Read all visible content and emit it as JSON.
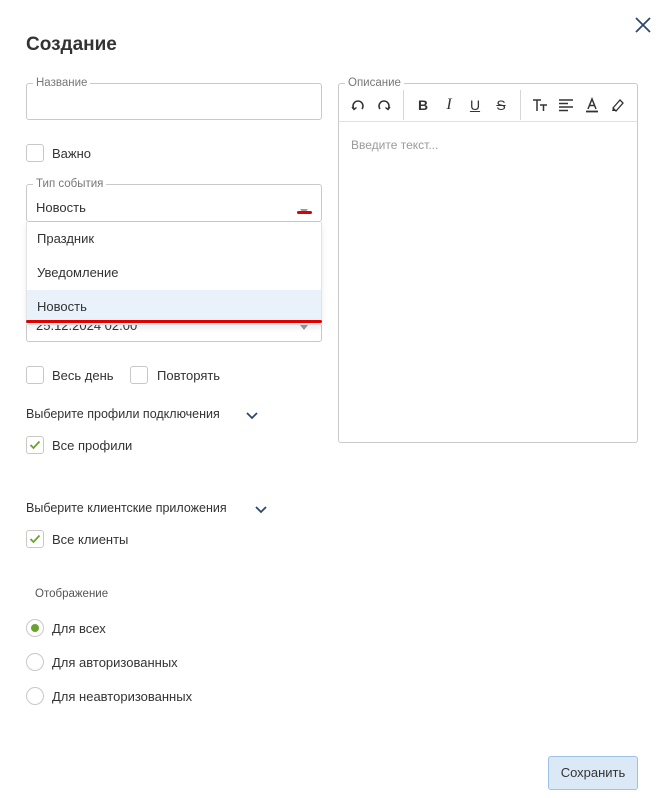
{
  "dialog": {
    "title": "Создание"
  },
  "name_field": {
    "legend": "Название",
    "value": ""
  },
  "important": {
    "label": "Важно",
    "checked": false
  },
  "event_type": {
    "legend": "Тип события",
    "value": "Новость",
    "options": [
      "Праздник",
      "Уведомление",
      "Новость"
    ],
    "selected_index": 2
  },
  "hidden_date_value": "25.12.2024 02:00",
  "all_day": {
    "label": "Весь день",
    "checked": false
  },
  "repeat": {
    "label": "Повторять",
    "checked": false
  },
  "profiles": {
    "label": "Выберите профили подключения",
    "all_label": "Все профили",
    "all_checked": true
  },
  "clients": {
    "label": "Выберите клиентские приложения",
    "all_label": "Все клиенты",
    "all_checked": true
  },
  "display": {
    "label": "Отображение",
    "options": [
      "Для всех",
      "Для авторизованных",
      "Для неавторизованных"
    ],
    "selected_index": 0
  },
  "description": {
    "legend": "Описание",
    "placeholder": "Введите текст...",
    "toolbar": [
      "undo-icon",
      "redo-icon",
      "bold-icon",
      "italic-icon",
      "underline-icon",
      "strikethrough-icon",
      "font-size-icon",
      "align-left-icon",
      "font-color-icon",
      "highlight-icon"
    ]
  },
  "buttons": {
    "save": "Сохранить"
  },
  "colors": {
    "accent_green": "#6aa22e",
    "annotation_red": "#e00000",
    "selected_bg": "#e9f1fb",
    "button_bg": "#dbe9f6",
    "chevron": "#2d4a6e"
  }
}
